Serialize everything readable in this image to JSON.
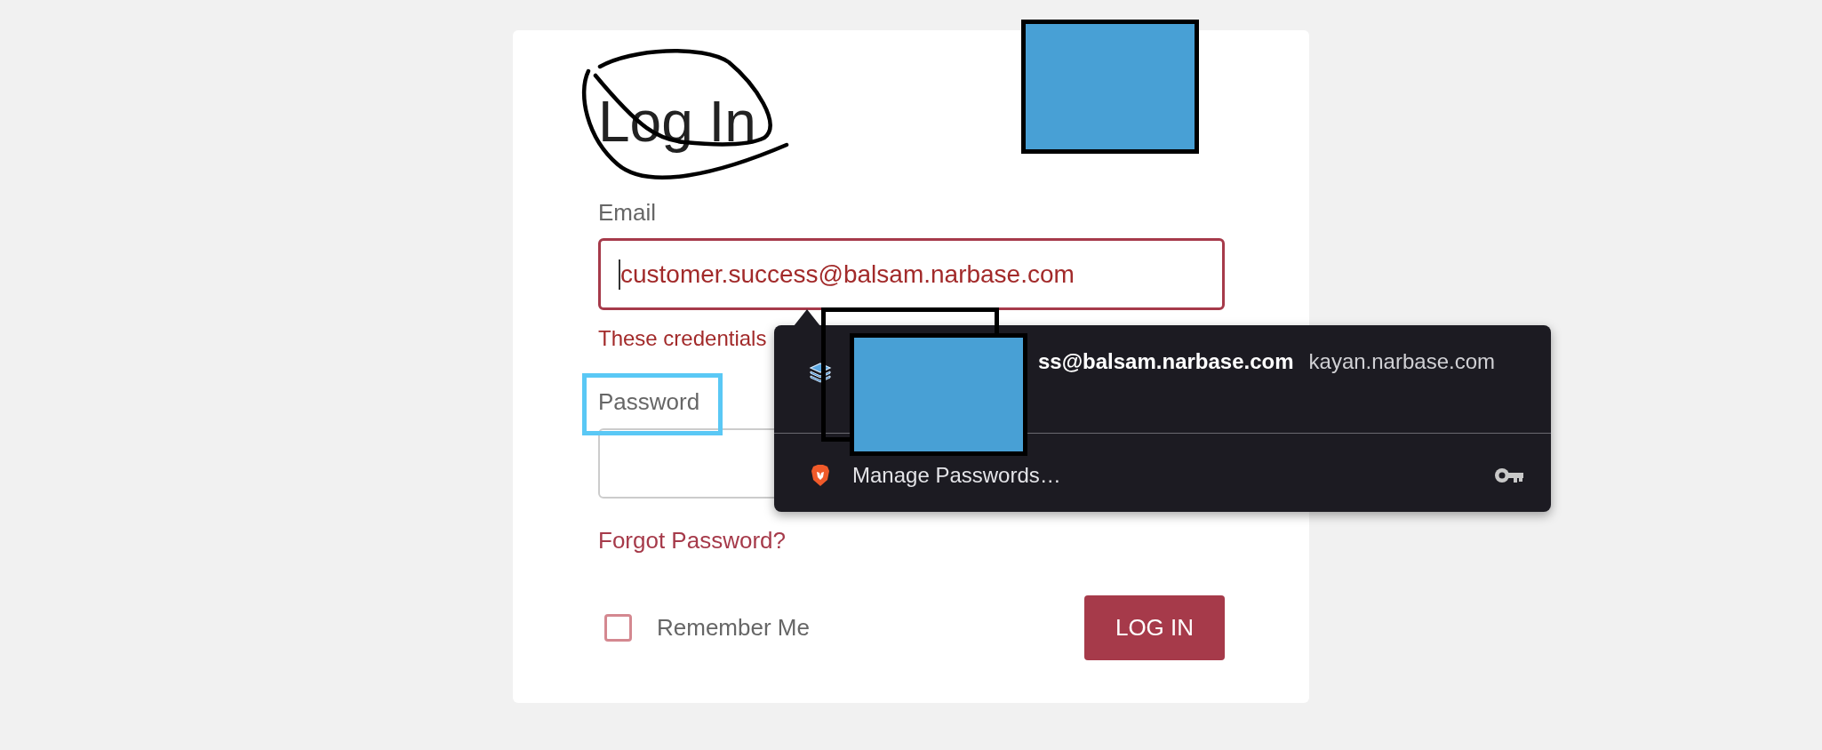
{
  "form": {
    "title": "Log In",
    "email": {
      "label": "Email",
      "value": "customer.success@balsam.narbase.com",
      "invalid": true
    },
    "error": "These credentials",
    "password": {
      "label": "Password"
    },
    "forgot": "Forgot Password?",
    "remember": {
      "label": "Remember Me",
      "checked": false
    },
    "submit": "LOG IN"
  },
  "autofill": {
    "entries": [
      {
        "kind": "credential",
        "username": "ss@balsam.narbase.com",
        "site": "kayan.narbase.com"
      },
      {
        "kind": "manage",
        "label": "Manage Passwords…"
      }
    ]
  }
}
